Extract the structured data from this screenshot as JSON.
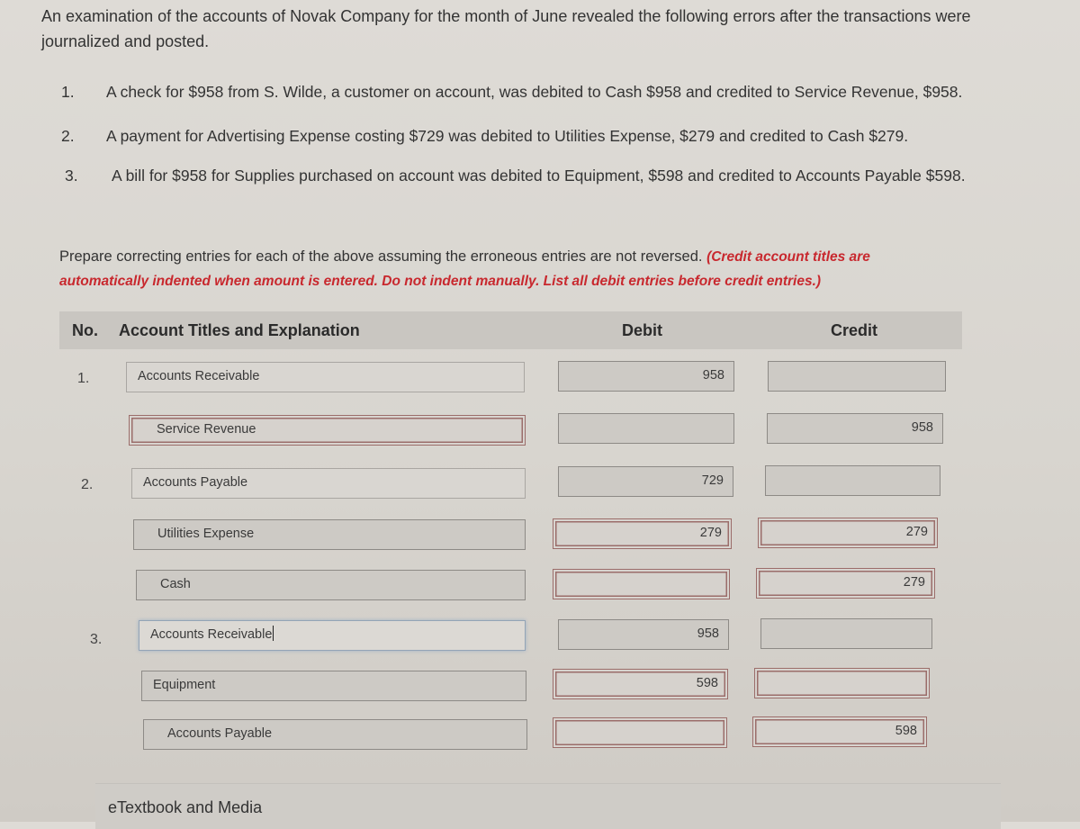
{
  "intro": "An examination of the accounts of Novak Company for the month of June revealed the following errors after the transactions were journalized and posted.",
  "errors": [
    {
      "num": "1.",
      "text": "A check for $958 from S. Wilde, a customer on account, was debited to Cash $958 and credited to Service Revenue, $958."
    },
    {
      "num": "2.",
      "text": "A payment for Advertising Expense costing $729 was debited to Utilities Expense, $279 and credited to Cash $279."
    },
    {
      "num": "3.",
      "text": "A bill for $958 for Supplies purchased on account was debited to Equipment, $598 and credited to Accounts Payable $598."
    }
  ],
  "instructions": {
    "text": "Prepare correcting entries for each of the above assuming the erroneous entries are not reversed. ",
    "note": "(Credit account titles are automatically indented when amount is entered. Do not indent manually. List all debit entries before credit entries.)"
  },
  "table": {
    "headers": {
      "no": "No.",
      "account": "Account Titles and Explanation",
      "debit": "Debit",
      "credit": "Credit"
    },
    "rows": [
      {
        "no": "1.",
        "account": "Accounts Receivable",
        "debit": "958",
        "credit": ""
      },
      {
        "no": "",
        "account": "Service Revenue",
        "debit": "",
        "credit": "958"
      },
      {
        "no": "2.",
        "account": "Accounts Payable",
        "debit": "729",
        "credit": ""
      },
      {
        "no": "",
        "account": "Utilities Expense",
        "debit": "279",
        "credit": "279"
      },
      {
        "no": "",
        "account": "Cash",
        "debit": "",
        "credit": "279"
      },
      {
        "no": "3.",
        "account": "Accounts Receivable",
        "debit": "958",
        "credit": ""
      },
      {
        "no": "",
        "account": "Equipment",
        "debit": "598",
        "credit": ""
      },
      {
        "no": "",
        "account": "Accounts Payable",
        "debit": "",
        "credit": "598"
      }
    ]
  },
  "footer": {
    "etextbook_label": "eTextbook and Media"
  }
}
